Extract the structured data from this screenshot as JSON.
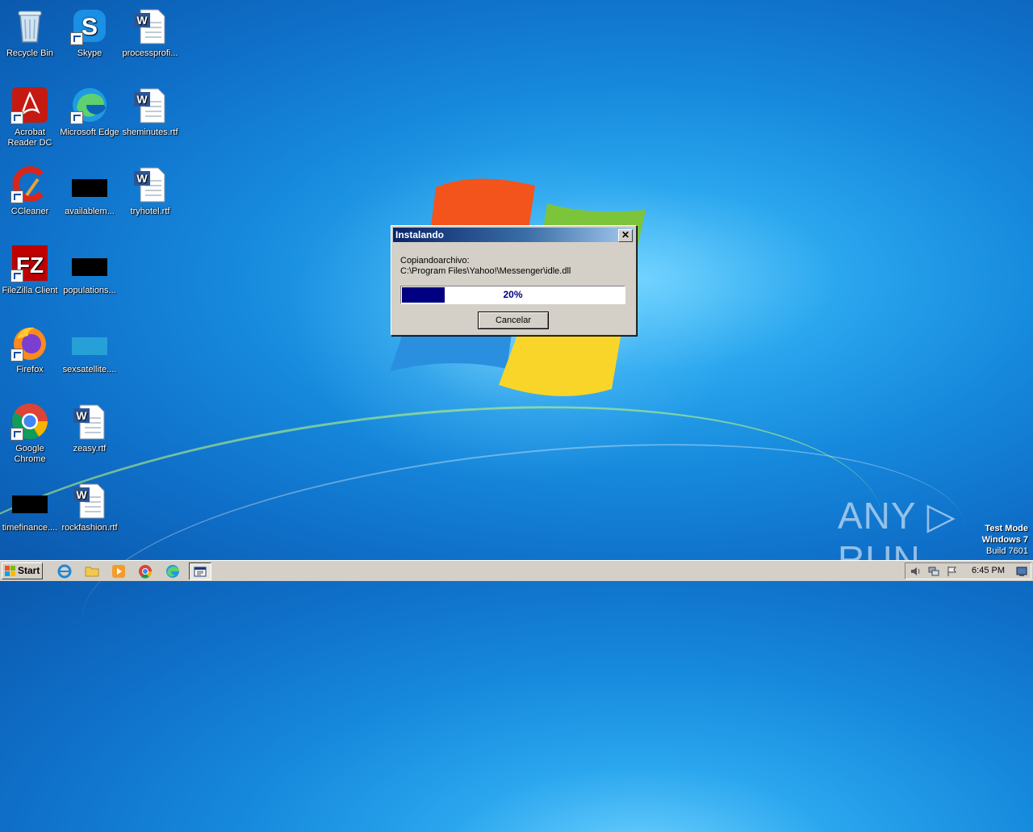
{
  "desktop": {
    "icons": [
      {
        "label": "Recycle Bin",
        "icon": "recycle-bin-icon"
      },
      {
        "label": "Skype",
        "icon": "skype-icon"
      },
      {
        "label": "processprofi...",
        "icon": "word-document-icon"
      },
      {
        "label": "Acrobat Reader DC",
        "icon": "acrobat-icon"
      },
      {
        "label": "Microsoft Edge",
        "icon": "edge-icon"
      },
      {
        "label": "sheminutes.rtf",
        "icon": "word-document-icon"
      },
      {
        "label": "CCleaner",
        "icon": "ccleaner-icon"
      },
      {
        "label": "availablem...",
        "icon": "file-icon"
      },
      {
        "label": "tryhotel.rtf",
        "icon": "word-document-icon"
      },
      {
        "label": "FileZilla Client",
        "icon": "filezilla-icon"
      },
      {
        "label": "populations...",
        "icon": "file-icon"
      },
      {
        "label": "Firefox",
        "icon": "firefox-icon"
      },
      {
        "label": "sexsatellite....",
        "icon": "file-icon"
      },
      {
        "label": "Google Chrome",
        "icon": "chrome-icon"
      },
      {
        "label": "zeasy.rtf",
        "icon": "word-document-icon"
      },
      {
        "label": "timefinance....",
        "icon": "file-icon"
      },
      {
        "label": "rockfashion.rtf",
        "icon": "word-document-icon"
      }
    ]
  },
  "dialog": {
    "title": "Instalando",
    "close_label": "✕",
    "status_line": "Copiandoarchivo:",
    "file_path": "C:\\Program Files\\Yahoo!\\Messenger\\idle.dll",
    "progress": 0.2,
    "progress_text": "20%",
    "cancel_label": "Cancelar"
  },
  "watermark": {
    "text": "ANY ▷ RUN",
    "test_mode": "Test Mode",
    "os": "Windows 7",
    "build": "Build 7601"
  },
  "taskbar": {
    "start_label": "Start",
    "clock": "6:45 PM",
    "quick_launch": [
      "internet-explorer-icon",
      "explorer-folder-icon",
      "media-player-icon",
      "chrome-icon",
      "edge-icon"
    ],
    "active_task_icon": "installer-icon",
    "tray_icons": [
      "volume-icon",
      "network-icon",
      "action-center-flag-icon",
      "show-desktop-icon"
    ]
  },
  "colors": {
    "titlebar_start": "#0a246a",
    "titlebar_end": "#a6caf0",
    "progress_fill": "#000080",
    "dialog_face": "#d4d0c8"
  }
}
